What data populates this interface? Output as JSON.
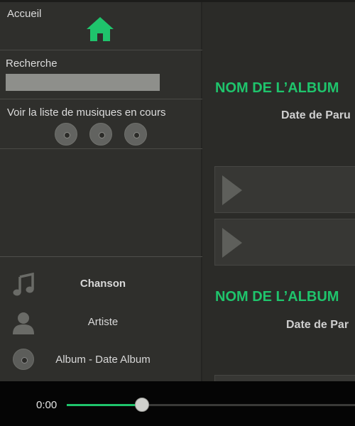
{
  "sidebar": {
    "home_label": "Accueil",
    "search": {
      "label": "Recherche",
      "value": "",
      "placeholder": ""
    },
    "queue_label": "Voir la liste de musiques en cours",
    "now_playing": {
      "song": "Chanson",
      "artist": "Artiste",
      "album": "Album - Date Album"
    }
  },
  "main": {
    "albums": [
      {
        "title": "NOM DE L’ALBUM",
        "date": "Date de Paru"
      },
      {
        "title": "NOM DE L’ALBUM",
        "date": "Date de Par"
      }
    ]
  },
  "player": {
    "time": "0:00",
    "progress_fraction": 0.26
  },
  "colors": {
    "accent": "#1fc46c",
    "sidebar_bg": "#2f2f2c",
    "main_bg": "#2b2b28",
    "player_bg": "#050505"
  },
  "icons": [
    "home-icon",
    "music-note-icon",
    "user-icon",
    "disc-icon",
    "play-icon"
  ]
}
